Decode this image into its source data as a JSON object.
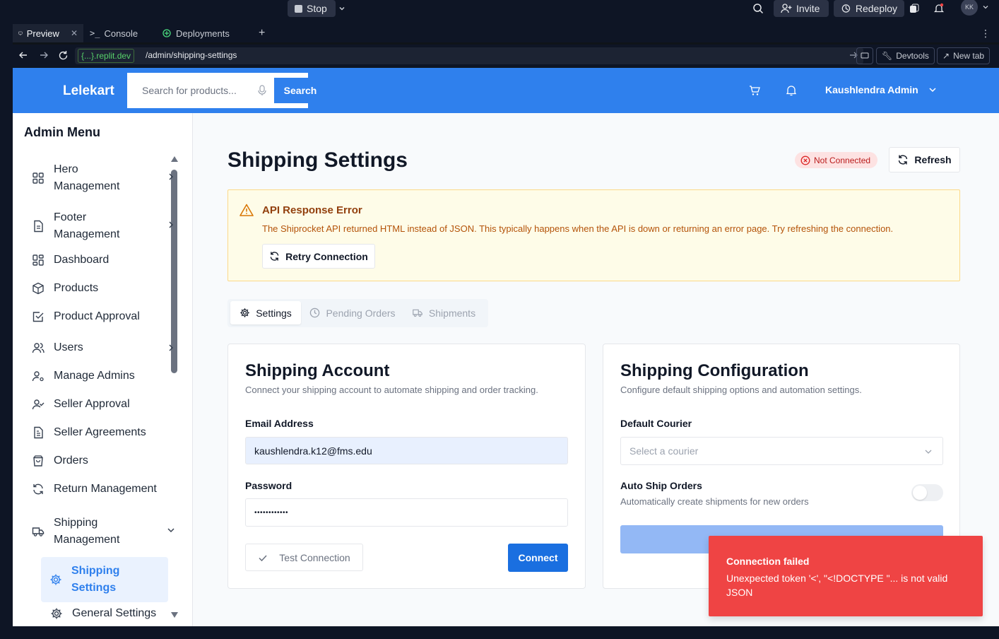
{
  "replit": {
    "stop_label": "Stop",
    "invite_label": "Invite",
    "redeploy_label": "Redeploy",
    "avatar_initials": "KK",
    "tabs": [
      {
        "label": "Preview"
      },
      {
        "label": "Console"
      },
      {
        "label": "Deployments"
      }
    ],
    "url_domain": "{...}.replit.dev",
    "url_path": "/admin/shipping-settings",
    "devtools_label": "Devtools",
    "newtab_label": "New tab"
  },
  "header": {
    "brand": "Lelekart",
    "search_placeholder": "Search for products...",
    "search_button": "Search",
    "user_name": "Kaushlendra Admin"
  },
  "sidebar": {
    "title": "Admin Menu",
    "items": [
      {
        "label": "Hero Management"
      },
      {
        "label": "Footer Management"
      },
      {
        "label": "Dashboard"
      },
      {
        "label": "Products"
      },
      {
        "label": "Product Approval"
      },
      {
        "label": "Users"
      },
      {
        "label": "Manage Admins"
      },
      {
        "label": "Seller Approval"
      },
      {
        "label": "Seller Agreements"
      },
      {
        "label": "Orders"
      },
      {
        "label": "Return Management"
      },
      {
        "label": "Shipping Management"
      },
      {
        "label": "Shipping Settings"
      },
      {
        "label": "General Settings"
      }
    ]
  },
  "page": {
    "title": "Shipping Settings",
    "status_badge": "Not Connected",
    "refresh_label": "Refresh",
    "alert": {
      "title": "API Response Error",
      "message": "The Shiprocket API returned HTML instead of JSON. This typically happens when the API is down or returning an error page. Try refreshing the connection.",
      "retry_label": "Retry Connection"
    },
    "tabs": [
      {
        "label": "Settings"
      },
      {
        "label": "Pending Orders"
      },
      {
        "label": "Shipments"
      }
    ],
    "account_card": {
      "title": "Shipping Account",
      "subtitle": "Connect your shipping account to automate shipping and order tracking.",
      "email_label": "Email Address",
      "email_value": "kaushlendra.k12@fms.edu",
      "password_label": "Password",
      "password_value": "••••••••••••",
      "test_label": "Test Connection",
      "connect_label": "Connect"
    },
    "config_card": {
      "title": "Shipping Configuration",
      "subtitle": "Configure default shipping options and automation settings.",
      "courier_label": "Default Courier",
      "courier_placeholder": "Select a courier",
      "auto_ship_label": "Auto Ship Orders",
      "auto_ship_desc": "Automatically create shipments for new orders",
      "auto_ship_enabled": false
    }
  },
  "toast": {
    "title": "Connection failed",
    "message": "Unexpected token '<', \"<!DOCTYPE \"... is not valid JSON"
  },
  "colors": {
    "brand_blue": "#2f80ed",
    "primary_button": "#1a6fe0",
    "toast_red": "#ef4444",
    "alert_bg": "#fefce8",
    "alert_text": "#b45309"
  }
}
